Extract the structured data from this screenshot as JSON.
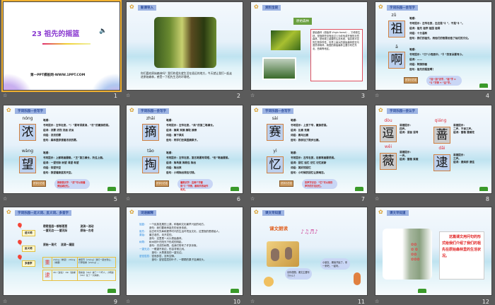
{
  "slides": [
    {
      "number": "1",
      "title": "23 祖先的摇篮",
      "footer": "第一PPT模板网-WWW.1PPT.COM"
    },
    {
      "number": "2",
      "header": "新课导入",
      "text": "你们喜欢原始森林吗？我们的祖先就生活在遥远的地方，今天就让我们一起走进原始森林，感受一下祖先生活的环境吧。"
    },
    {
      "number": "3",
      "header": "资料宝袋",
      "subheader": "原始森林",
      "text": "原始森林（原始林 Virgin forest），又称原生林，是指那些没有经过人为砍伐或开垦的天然森林，是地球上重要的生态系统，保存着丰富的生物多样性。世界上最大的原始森林是亚马逊热带雨林，我国的原始森林主要分布在东北、西南等地区。"
    },
    {
      "number": "4",
      "header": "字词乐园—会写字",
      "chars": [
        {
          "pinyin": "zǔ",
          "char": "祖",
          "lines": [
            "笔顺：",
            "书写提示：左窄右宽，左边是“礻”，不是“衤”。",
            "组词：祖先 祖宗 祖国 祖母",
            "词组：十分温和",
            "造句：我们的祖先，用他们的智慧创造了灿烂的文化。"
          ]
        },
        {
          "pinyin": "ā",
          "char": "啊",
          "lines": [
            "笔顺：",
            "书写提示：“口”小而居中，“阝”的耳朵要写小。",
            "组词：——",
            "词组：阿姨快看",
            "造句：祖先的摇篮啊！"
          ]
        }
      ],
      "sign": "识字小方法",
      "cloud": "“加一加”识字，“祖”字 = “礻”字旁 + “且”字。"
    },
    {
      "number": "5",
      "header": "字词乐园—会写字",
      "chars": [
        {
          "pinyin": "nóng",
          "char": "浓",
          "lines": [
            "笔顺：",
            "书写提示：左窄右宽，“氵”要写得紧凑，“农”的撇捺舒展。",
            "组词：浓雾 浓烈 浓眉 浓淡",
            "词组：浓浓的雾",
            "造句：森林里弥漫着浓浓的雾。"
          ]
        },
        {
          "pinyin": "wàng",
          "char": "望",
          "lines": [
            "笔顺：",
            "书写提示：上部笔画要稳，“王”第三横长，托住上面。",
            "组词：一望无际 盼望 渴望 希望",
            "词组：仰望天空",
            "造句：我望着蔚蓝的天空。"
          ]
        }
      ],
      "sign": "识字小方法",
      "cloud": "换部首识字：“浓”可以用偏旁加减记忆。"
    },
    {
      "number": "6",
      "header": "字词乐园—会写字",
      "chars": [
        {
          "pinyin": "zhāi",
          "char": "摘",
          "lines": [
            "笔顺：",
            "书写提示：左窄右宽，“商”的第二笔横长。",
            "组词：摘果 采摘 摘取 摘录",
            "词组：摘下果实",
            "造句：同学们去果园摘果子。"
          ]
        },
        {
          "pinyin": "tāo",
          "char": "掏",
          "lines": [
            "笔顺：",
            "书写提示：左窄右宽，第五笔要写得短，“缶”笔画要紧。",
            "组词：掏鸟蛋 掏钱包 掏出",
            "词组：掏出来",
            "造句：小明掏出钱包付钱。"
          ]
        }
      ],
      "sign": "识字小方法",
      "cloud": "偏旁识字：这两个字都有“扌”字旁，都和手的动作有关。"
    },
    {
      "number": "7",
      "header": "字词乐园—会写字",
      "chars": [
        {
          "pinyin": "sài",
          "char": "赛",
          "lines": [
            "笔顺：",
            "书写提示：上宽下窄，撇捺舒展。",
            "组词：比赛 竞赛",
            "词组：赛马比赛",
            "造句：我参加了跑步比赛。"
          ]
        },
        {
          "pinyin": "yì",
          "char": "忆",
          "lines": [
            "笔顺：",
            "书写提示：左窄右宽，右部笔画要舒展。",
            "组词：回忆 追忆 记忆 记忆犹新",
            "词组：美好的回忆",
            "造句：小时候的回忆让我难忘。"
          ]
        }
      ],
      "sign": "识字小方法",
      "cloud": "形声字识记：“忆”可以用形声字的方法记忆。"
    },
    {
      "number": "8",
      "header": "字词乐园—会认字",
      "chars": [
        {
          "pinyin": "dòu",
          "char": "逗",
          "lines": [
            "易错提示：",
            "四声。",
            "组词：逗留 逗号"
          ]
        },
        {
          "pinyin": "qiáng",
          "char": "蔷",
          "lines": [
            "易错提示：",
            "二声，不读三声。",
            "组词：蔷薇 蔷薇花"
          ]
        },
        {
          "pinyin": "wēi",
          "char": "薇",
          "lines": [
            "易错提示：",
            "一声。",
            "组词：蔷薇 紫薇"
          ]
        },
        {
          "pinyin": "dǎi",
          "char": "逮",
          "lines": [
            "易错提示：",
            "三声。",
            "组词：逮蚂蚱 逮住"
          ]
        }
      ]
    },
    {
      "number": "9",
      "header": "字词乐园—近义词、反义词、多音字",
      "synonyms_label": "近义词",
      "synonyms": [
        "密密层层～郁郁葱葱",
        "流淌～流动",
        "一望无边～一望无际",
        "原始～古老"
      ],
      "antonyms_label": "反义词",
      "antonyms": [
        "原始～现代",
        "流淌～凝固"
      ],
      "polyphone_label": "多音字",
      "polyphones": [
        {
          "char": "重",
          "readings": "chóng（重复）  zhòng（重要）",
          "example": "重阳节（chóng）我们一起去登山，行李很重（zhòng）。"
        },
        {
          "char": "逮",
          "readings": "dǎi（逮住）  dài（逮捕）",
          "example": "警察逮（dài）捕了一个坏人，小明逮（dǎi）住了一只蚂蚱。"
        }
      ]
    },
    {
      "number": "10",
      "header": "词语解释",
      "entries": [
        {
          "term": "摇篮：",
          "lines": [
            "一个民族发展的上源，种植和文化最早兴起的地方。",
            "造句：我们要继承祖先的优良传统。"
          ]
        },
        {
          "term": "祖先：",
          "lines": [
            "远古时代先辈和更早时代的生活环境及文化，这里指的是原始人。"
          ]
        },
        {
          "term": "原始：",
          "lines": [
            "最古老的，未开发的。",
            "造句：这里是一大片原始森林。"
          ]
        },
        {
          "term": "树荫：",
          "lines": [
            "树木枝叶在阳光下形成的阴影。",
            "造句：浓浓的树荫，给我们带来了许多凉爽。"
          ]
        },
        {
          "term": "一望无边：",
          "lines": [
            "一眼望不到边，形容非常辽阔。",
            "造句：大草原真的一望无边。"
          ]
        },
        {
          "term": "密密层层：",
          "lines": [
            "密而多层，没有空隙。",
            "造句：密密层层的叶子，一颗颗的果子挂满枝头。"
          ]
        }
      ]
    },
    {
      "number": "11",
      "header": "课文早知道",
      "reading_title": "课文朗读",
      "bubble_left": "请你想想，课文主要写了什么？",
      "bubble_right": "小朋友，朗读开始了，来一来吧，一起听。"
    },
    {
      "number": "12",
      "header": "课文早知道",
      "summary": "这篇课文用问句的形式给我们介绍了我们的祖先在原始森林里的生活状况。"
    }
  ]
}
